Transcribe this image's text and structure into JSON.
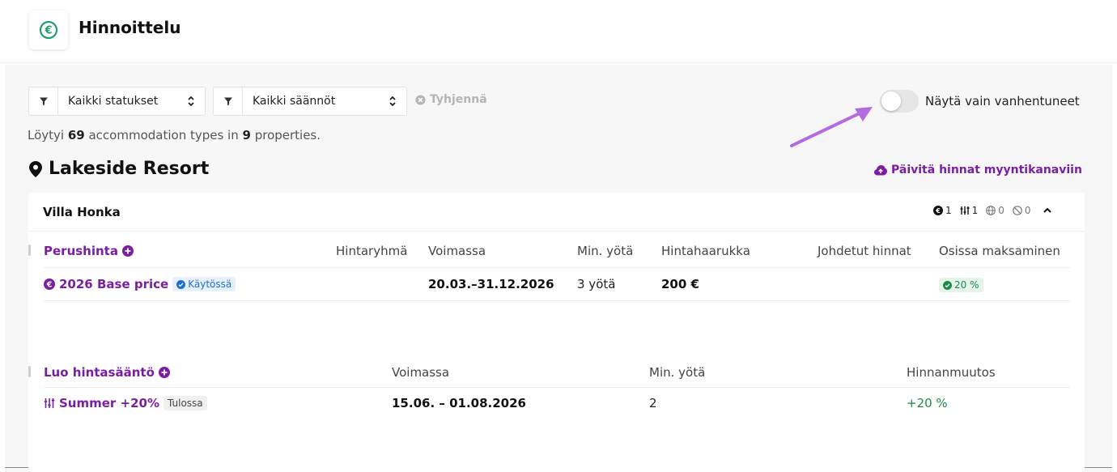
{
  "header": {
    "title": "Hinnoittelu",
    "logo_icon": "euro-circle-icon",
    "accent": "#1e9e6a"
  },
  "filters": {
    "status_select": "Kaikki statukset",
    "rules_select": "Kaikki säännöt",
    "clear_label": "Tyhjennä",
    "toggle_label": "Näytä vain vanhentuneet",
    "toggle_on": false
  },
  "summary": {
    "prefix": "Löytyi ",
    "accommodation_count": "69",
    "middle": " accommodation types in ",
    "property_count": "9",
    "suffix": " properties."
  },
  "property": {
    "name": "Lakeside Resort",
    "update_link": "Päivitä hinnat myyntikanaviin"
  },
  "card": {
    "title": "Villa Honka",
    "stats": {
      "base": "1",
      "rules": "1",
      "channels": "0",
      "blocked": "0"
    },
    "base_table": {
      "title": "Perushinta",
      "headers": [
        "Hintaryhmä",
        "Voimassa",
        "Min. yötä",
        "Hintahaarukka",
        "Johdetut hinnat",
        "Osissa maksaminen"
      ],
      "row": {
        "name": "2026 Base price",
        "status": "Käytössä",
        "group": "",
        "valid": "20.03.–31.12.2026",
        "min_nights": "3 yötä",
        "price_range": "200 €",
        "derived": "",
        "installment": "20 %"
      }
    },
    "rule_table": {
      "title": "Luo hintasääntö",
      "headers": [
        "Voimassa",
        "Min. yötä",
        "Hinnanmuutos"
      ],
      "row": {
        "name": "Summer +20%",
        "status": "Tulossa",
        "valid": "15.06. – 01.08.2026",
        "min_nights": "2",
        "change": "+20 %"
      }
    }
  },
  "colors": {
    "purple": "#7a1fa2",
    "green": "#1e8a4a",
    "blue": "#1f6fd1",
    "arrow": "#b56be0"
  }
}
